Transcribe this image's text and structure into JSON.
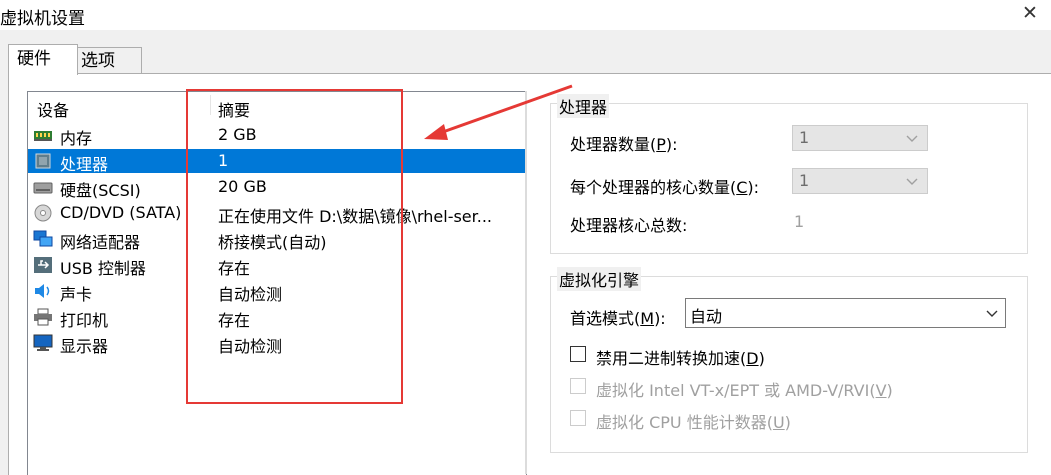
{
  "window": {
    "title": "虚拟机设置",
    "close_label": "✕"
  },
  "tabs": [
    {
      "label": "硬件",
      "active": true
    },
    {
      "label": "选项",
      "active": false
    }
  ],
  "device_list": {
    "columns": [
      "设备",
      "摘要"
    ],
    "rows": [
      {
        "name": "内存",
        "summary": "2 GB",
        "icon": "memory-icon",
        "selected": false
      },
      {
        "name": "处理器",
        "summary": "1",
        "icon": "processor-icon",
        "selected": true
      },
      {
        "name": "硬盘(SCSI)",
        "summary": "20 GB",
        "icon": "hard-disk-icon",
        "selected": false
      },
      {
        "name": "CD/DVD (SATA)",
        "summary": "正在使用文件 D:\\数据\\镜像\\rhel-ser...",
        "icon": "cd-dvd-icon",
        "selected": false
      },
      {
        "name": "网络适配器",
        "summary": "桥接模式(自动)",
        "icon": "network-adapter-icon",
        "selected": false
      },
      {
        "name": "USB 控制器",
        "summary": "存在",
        "icon": "usb-icon",
        "selected": false
      },
      {
        "name": "声卡",
        "summary": "自动检测",
        "icon": "sound-card-icon",
        "selected": false
      },
      {
        "name": "打印机",
        "summary": "存在",
        "icon": "printer-icon",
        "selected": false
      },
      {
        "name": "显示器",
        "summary": "自动检测",
        "icon": "display-icon",
        "selected": false
      }
    ]
  },
  "processor_group": {
    "title": "处理器",
    "count_label_pre": "处理器数量(",
    "count_label_key": "P",
    "count_label_post": "):",
    "count_value": "1",
    "cores_label_pre": "每个处理器的核心数量(",
    "cores_label_key": "C",
    "cores_label_post": "):",
    "cores_value": "1",
    "total_label": "处理器核心总数:",
    "total_value": "1"
  },
  "virtualization_group": {
    "title": "虚拟化引擎",
    "mode_label_pre": "首选模式(",
    "mode_label_key": "M",
    "mode_label_post": "):",
    "mode_value": "自动",
    "checkboxes": [
      {
        "pre": "禁用二进制转换加速(",
        "key": "D",
        "post": ")",
        "checked": false,
        "enabled": true
      },
      {
        "pre": "虚拟化 Intel VT-x/EPT 或 AMD-V/RVI(",
        "key": "V",
        "post": ")",
        "checked": false,
        "enabled": false
      },
      {
        "pre": "虚拟化 CPU 性能计数器(",
        "key": "U",
        "post": ")",
        "checked": false,
        "enabled": false
      }
    ]
  },
  "colors": {
    "selection": "#0078d7",
    "annotation": "#e53935",
    "disabled_text": "#a0a0a0"
  }
}
